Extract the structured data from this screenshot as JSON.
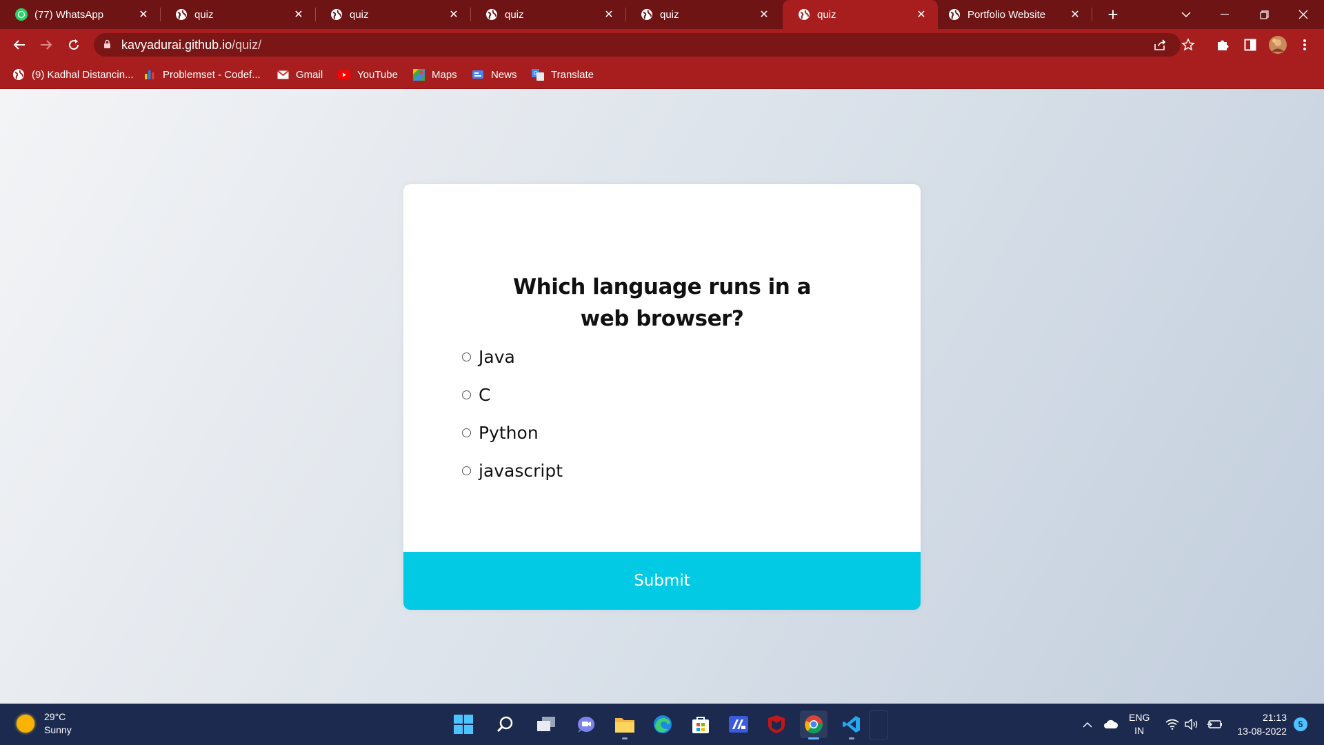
{
  "browser": {
    "tabs": [
      {
        "title": "(77) WhatsApp",
        "icon": "whatsapp-icon",
        "active": false
      },
      {
        "title": "quiz",
        "icon": "globe-icon",
        "active": false
      },
      {
        "title": "quiz",
        "icon": "globe-icon",
        "active": false
      },
      {
        "title": "quiz",
        "icon": "globe-icon",
        "active": false
      },
      {
        "title": "quiz",
        "icon": "globe-icon",
        "active": false
      },
      {
        "title": "quiz",
        "icon": "globe-icon",
        "active": true
      },
      {
        "title": "Portfolio Website",
        "icon": "globe-icon",
        "active": false
      }
    ],
    "url": {
      "host": "kavyadurai.github.io",
      "path": "/quiz/"
    },
    "bookmarks": [
      {
        "label": "(9) Kadhal Distancin...",
        "icon": "globe-icon"
      },
      {
        "label": "Problemset - Codef...",
        "icon": "codeforces-icon"
      },
      {
        "label": "Gmail",
        "icon": "gmail-icon"
      },
      {
        "label": "YouTube",
        "icon": "youtube-icon"
      },
      {
        "label": "Maps",
        "icon": "maps-icon"
      },
      {
        "label": "News",
        "icon": "news-icon"
      },
      {
        "label": "Translate",
        "icon": "translate-icon"
      }
    ],
    "colors": {
      "frame": "#6e1414",
      "toolbar": "#a81e1e",
      "omnibox": "#7a1616"
    }
  },
  "quiz": {
    "question": "Which language runs in a web browser?",
    "answers": [
      "Java",
      "C",
      "Python",
      "javascript"
    ],
    "submit_label": "Submit",
    "accent": "#03cae4"
  },
  "taskbar": {
    "weather": {
      "temp": "29°C",
      "condition": "Sunny"
    },
    "apps": [
      "start-icon",
      "search-icon",
      "task-view-icon",
      "teams-chat-icon",
      "file-explorer-icon",
      "edge-icon",
      "store-icon",
      "app-icon",
      "mcafee-icon",
      "chrome-icon",
      "vscode-icon"
    ],
    "language": {
      "line1": "ENG",
      "line2": "IN"
    },
    "time": "21:13",
    "date": "13-08-2022",
    "notifications": "5"
  }
}
